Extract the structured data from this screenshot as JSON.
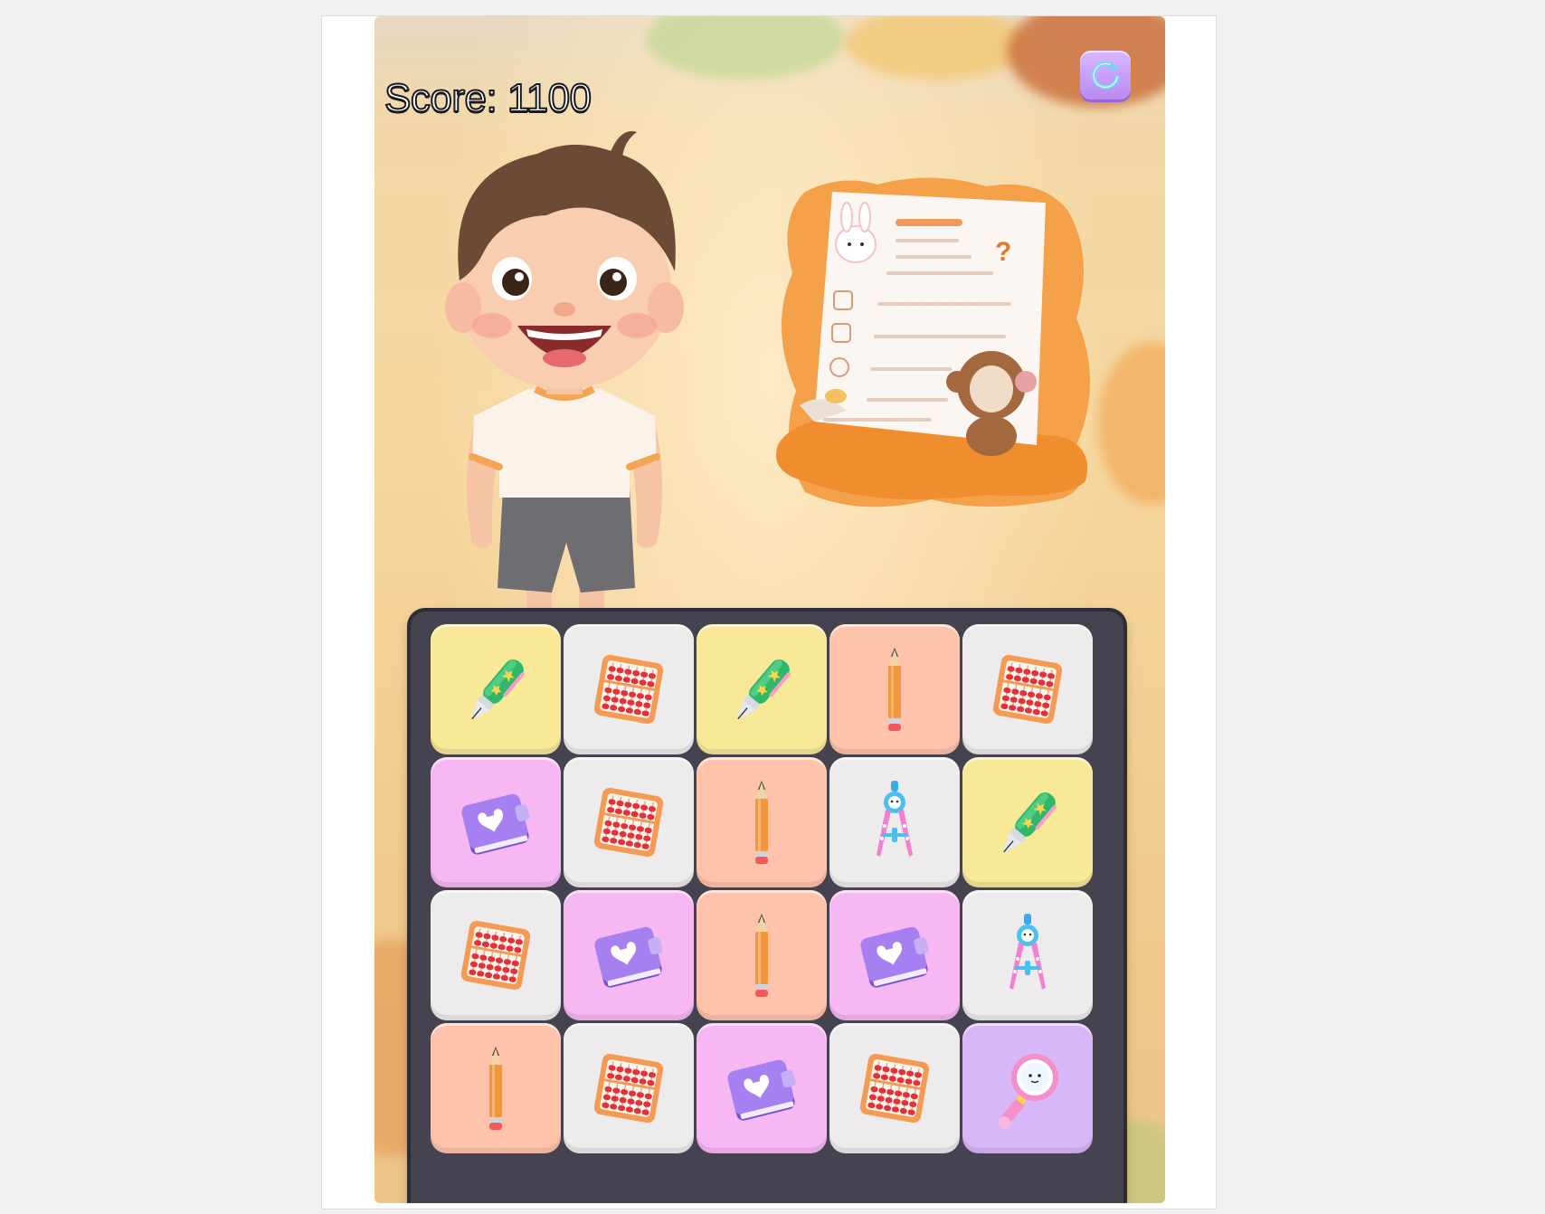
{
  "game": {
    "score_text": "Score: 1100",
    "score": 1100
  },
  "controls": {
    "restart_icon": "refresh-icon"
  },
  "colors": {
    "yellow": "#f8e998",
    "white": "#eeebec",
    "peach": "#ffc3ab",
    "pink": "#f6b7f2",
    "lavender": "#d8b7f8"
  },
  "board": {
    "rows": [
      [
        {
          "item": "fountain-pen",
          "color": "yellow"
        },
        {
          "item": "abacus",
          "color": "white"
        },
        {
          "item": "fountain-pen",
          "color": "yellow"
        },
        {
          "item": "pencil",
          "color": "peach"
        },
        {
          "item": "abacus",
          "color": "white"
        }
      ],
      [
        {
          "item": "notebook",
          "color": "pink"
        },
        {
          "item": "abacus",
          "color": "white"
        },
        {
          "item": "pencil",
          "color": "peach"
        },
        {
          "item": "compass",
          "color": "white"
        },
        {
          "item": "fountain-pen",
          "color": "yellow"
        }
      ],
      [
        {
          "item": "abacus",
          "color": "white"
        },
        {
          "item": "notebook",
          "color": "pink"
        },
        {
          "item": "pencil",
          "color": "peach"
        },
        {
          "item": "notebook",
          "color": "pink"
        },
        {
          "item": "compass",
          "color": "white"
        }
      ],
      [
        {
          "item": "pencil",
          "color": "peach"
        },
        {
          "item": "abacus",
          "color": "white"
        },
        {
          "item": "notebook",
          "color": "pink"
        },
        {
          "item": "abacus",
          "color": "white"
        },
        {
          "item": "magnifier",
          "color": "lavender"
        }
      ]
    ]
  }
}
